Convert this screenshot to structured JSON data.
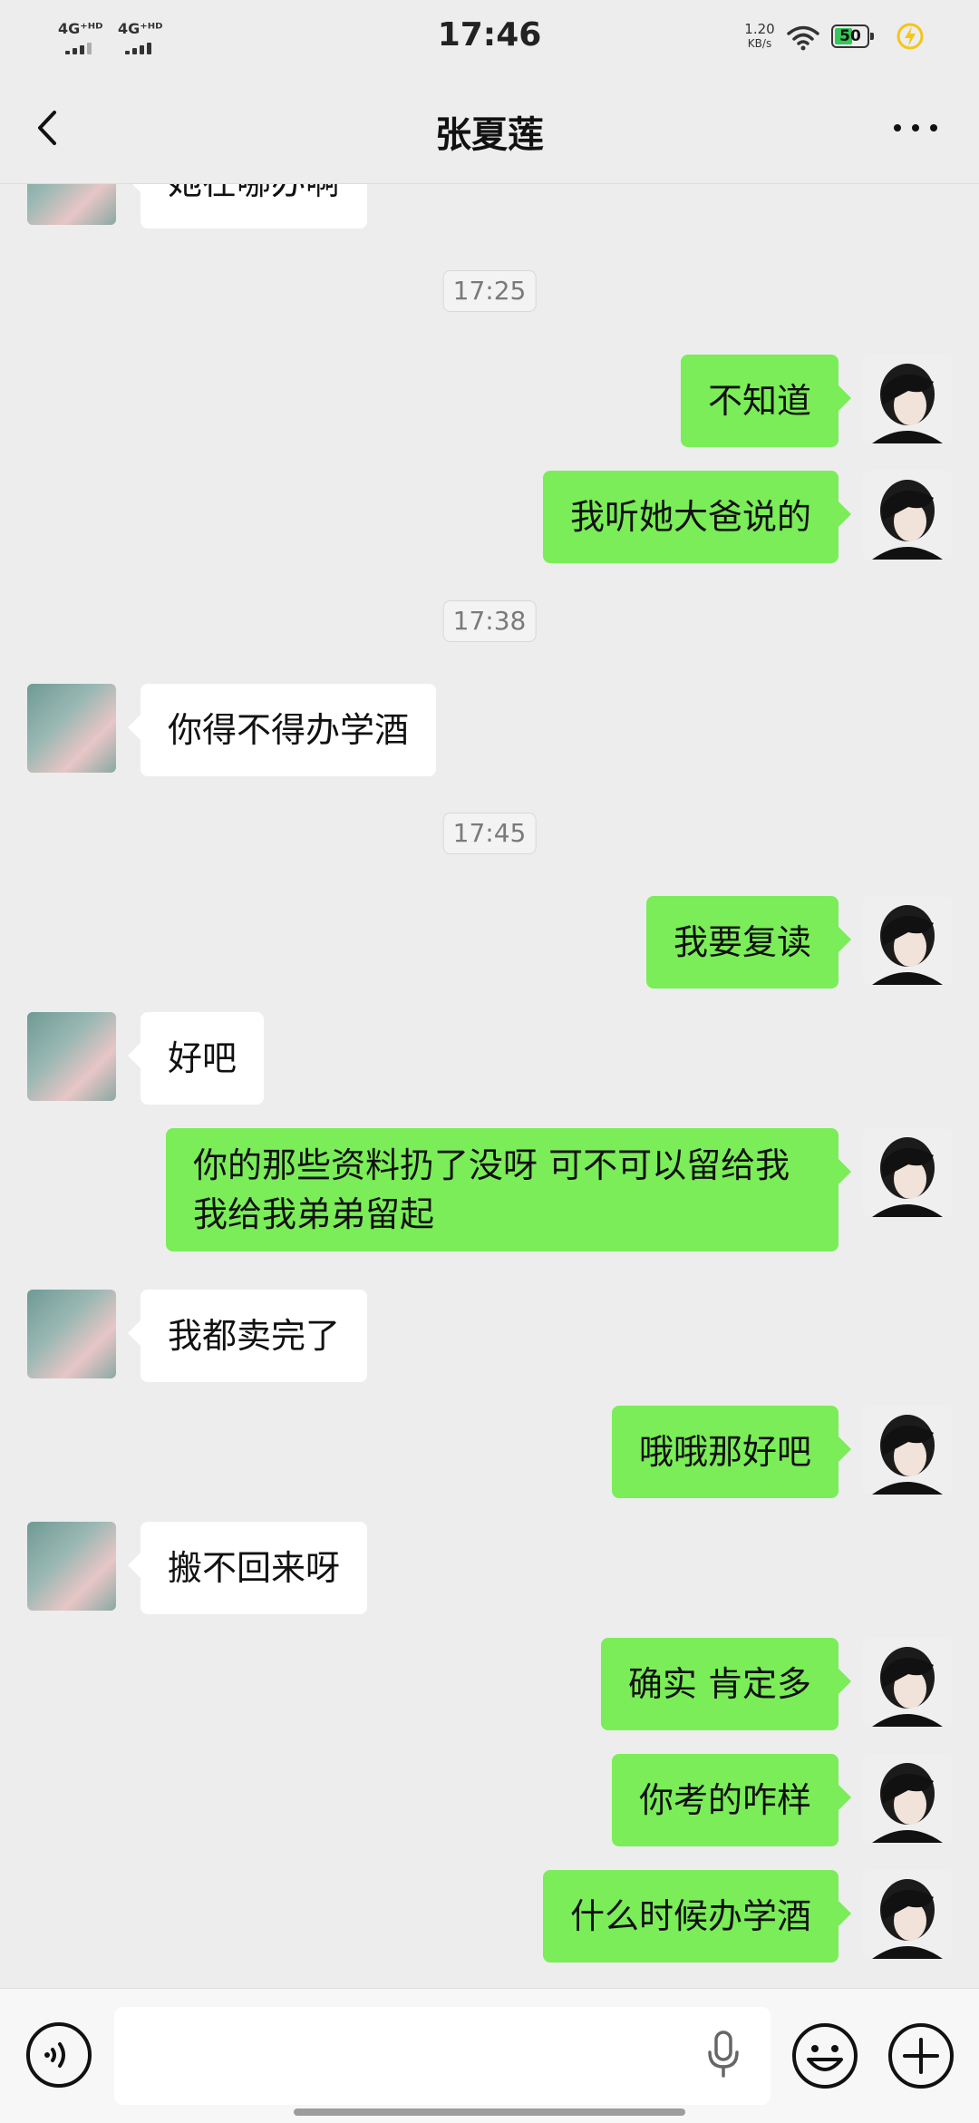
{
  "status_bar": {
    "time": "17:46",
    "signal1": "4G⁺ᴴᴰ",
    "signal2": "4G⁺ᴴᴰ",
    "speed_value": "1.20",
    "speed_unit": "KB/s",
    "battery": "50",
    "battery_level": 0.5
  },
  "nav": {
    "title": "张夏莲"
  },
  "messages": [
    {
      "type": "in",
      "text": "她在哪办啊"
    },
    {
      "type": "time",
      "text": "17:25"
    },
    {
      "type": "out",
      "text": "不知道"
    },
    {
      "type": "out",
      "text": "我听她大爸说的"
    },
    {
      "type": "time",
      "text": "17:38"
    },
    {
      "type": "in",
      "text": "你得不得办学酒"
    },
    {
      "type": "time",
      "text": "17:45"
    },
    {
      "type": "out",
      "text": "我要复读"
    },
    {
      "type": "in",
      "text": "好吧"
    },
    {
      "type": "out",
      "text": "你的那些资料扔了没呀 可不可以留给我 我给我弟弟留起"
    },
    {
      "type": "in",
      "text": "我都卖完了"
    },
    {
      "type": "out",
      "text": "哦哦那好吧"
    },
    {
      "type": "in",
      "text": "搬不回来呀"
    },
    {
      "type": "out",
      "text": "确实 肯定多"
    },
    {
      "type": "out",
      "text": "你考的咋样"
    },
    {
      "type": "out",
      "text": "什么时候办学酒"
    }
  ],
  "input": {
    "value": ""
  },
  "colors": {
    "out_bubble": "#7aed58",
    "in_bubble": "#ffffff",
    "background": "#ededed"
  },
  "icons": [
    "back-arrow-icon",
    "more-icon",
    "voice-icon",
    "microphone-icon",
    "emoji-icon",
    "plus-icon",
    "wifi-icon",
    "battery-icon",
    "charging-icon"
  ]
}
